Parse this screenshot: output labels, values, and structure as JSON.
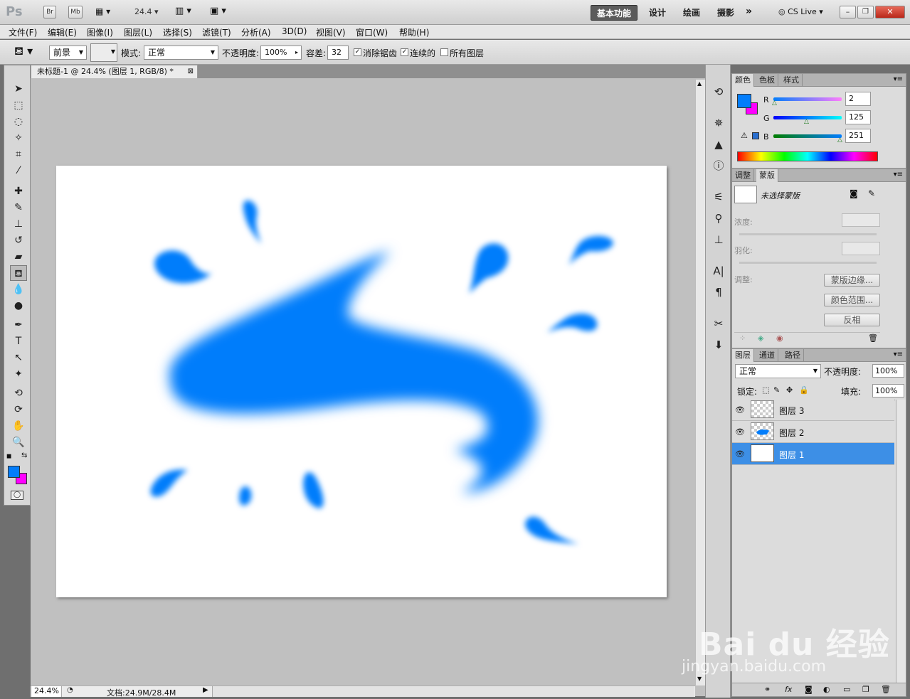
{
  "appbar": {
    "logo": "Ps",
    "bridge": "Br",
    "minibridge": "Mb",
    "zoom": "24.4",
    "workspaces": [
      "基本功能",
      "设计",
      "绘画",
      "摄影"
    ],
    "cslive": "CS Live"
  },
  "menu": [
    "文件(F)",
    "编辑(E)",
    "图像(I)",
    "图层(L)",
    "选择(S)",
    "滤镜(T)",
    "分析(A)",
    "3D(D)",
    "视图(V)",
    "窗口(W)",
    "帮助(H)"
  ],
  "options": {
    "fill_source": "前景",
    "mode_label": "模式:",
    "mode_value": "正常",
    "opacity_label": "不透明度:",
    "opacity_value": "100%",
    "tolerance_label": "容差:",
    "tolerance_value": "32",
    "antialias": "消除锯齿",
    "contiguous": "连续的",
    "all_layers": "所有图层"
  },
  "document": {
    "tab_title": "未标题-1 @ 24.4% (图层 1, RGB/8) *",
    "zoom": "24.4%",
    "doc_size": "文档:24.9M/28.4M"
  },
  "color_panel": {
    "tabs": [
      "颜色",
      "色板",
      "样式"
    ],
    "r": "2",
    "g": "125",
    "b": "251",
    "r_label": "R",
    "g_label": "G",
    "b_label": "B",
    "fg_color": "#027dfb",
    "bg_color": "#ff00ff"
  },
  "mask_panel": {
    "tabs": [
      "调整",
      "蒙版"
    ],
    "status": "未选择蒙版",
    "density": "浓度:",
    "feather": "羽化:",
    "refine": "调整:",
    "btn_edge": "蒙版边缘...",
    "btn_range": "颜色范围...",
    "btn_invert": "反相"
  },
  "layers_panel": {
    "tabs": [
      "图层",
      "通道",
      "路径"
    ],
    "blend": "正常",
    "opacity_label": "不透明度:",
    "opacity": "100%",
    "lock_label": "锁定:",
    "fill_label": "填充:",
    "fill": "100%",
    "layers": [
      {
        "name": "图层 3"
      },
      {
        "name": "图层 2"
      },
      {
        "name": "图层 1"
      }
    ]
  },
  "watermark": {
    "brand": "Bai du 经验",
    "url": "jingyan.baidu.com"
  }
}
